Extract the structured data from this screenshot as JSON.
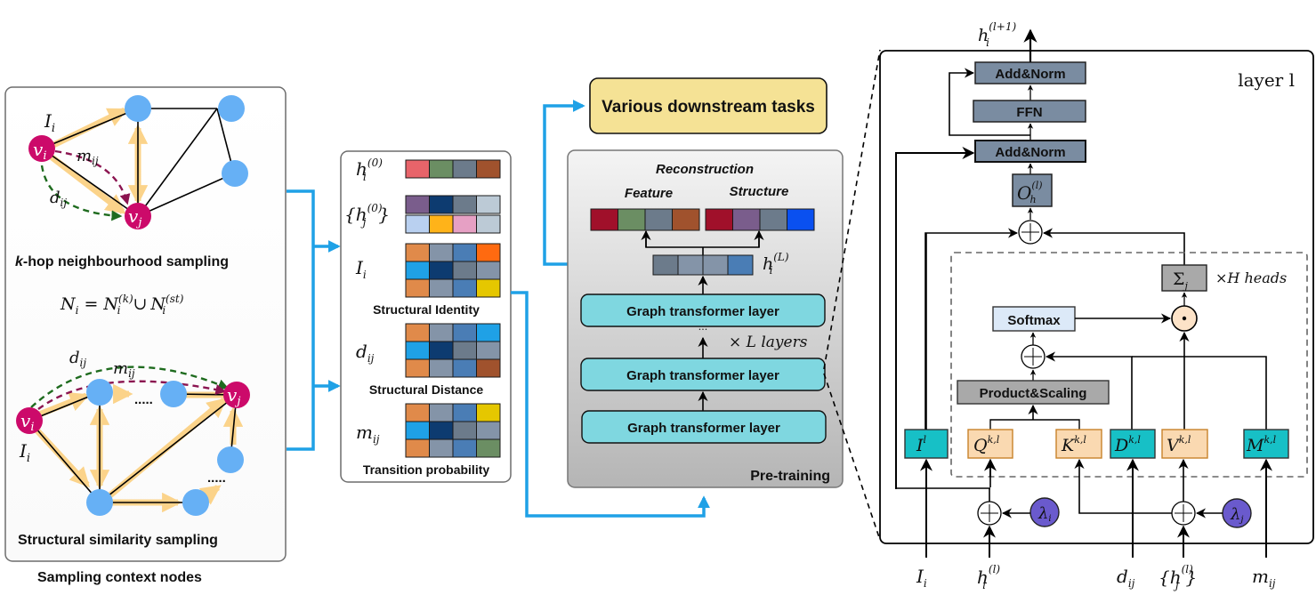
{
  "sampling_panel": {
    "caption": "Sampling context nodes",
    "khop": {
      "title_prefix": "k",
      "title_rest": "-hop neighbourhood sampling",
      "node_i": "v",
      "node_i_sub": "i",
      "node_j": "v",
      "node_j_sub": "j",
      "I_label": "I",
      "I_sub": "i",
      "m_label": "m",
      "m_sub": "ij",
      "d_label": "d",
      "d_sub": "ij"
    },
    "formula": {
      "lhs": "N",
      "lhs_sub": "i",
      "eq": "=",
      "t1": "N",
      "t1_sub": "i",
      "t1_sup": "(k)",
      "union": "∪",
      "t2": "N",
      "t2_sub": "i",
      "t2_sup": "(st)"
    },
    "structural": {
      "title": "Structural similarity sampling",
      "dots": ".....",
      "node_i": "v",
      "node_i_sub": "i",
      "node_j": "v",
      "node_j_sub": "j",
      "I_label": "I",
      "I_sub": "i",
      "d_label": "d",
      "d_sub": "ij",
      "m_label": "m",
      "m_sub": "ij"
    }
  },
  "feature_panel": {
    "rows": [
      {
        "label": "h",
        "sub": "i",
        "sup": "(0)",
        "colors": [
          [
            "#e8646a",
            "#6b8e63",
            "#6c7b8b",
            "#a0522d"
          ]
        ]
      },
      {
        "label": "{h",
        "sub": "j",
        "sup": "(0)",
        "suffix": "}",
        "colors": [
          [
            "#7a5d8c",
            "#0d3b70",
            "#6c7b8b",
            "#bccad6"
          ],
          [
            "#b9d0f0",
            "#ffb319",
            "#e6a0c4",
            "#bccad6"
          ]
        ]
      },
      {
        "label": "I",
        "sub": "i",
        "caption": "Structural Identity",
        "colors": [
          [
            "#e08a4a",
            "#8494a8",
            "#4a7db5",
            "#ff6a10"
          ],
          [
            "#1fa1e6",
            "#0d3b70",
            "#6c7b8b",
            "#8494a8"
          ],
          [
            "#e08a4a",
            "#8494a8",
            "#4a7db5",
            "#e5c700"
          ]
        ]
      },
      {
        "label": "d",
        "sub": "ij",
        "caption": "Structural Distance",
        "colors": [
          [
            "#e08a4a",
            "#8494a8",
            "#4a7db5",
            "#1fa1e6"
          ],
          [
            "#1fa1e6",
            "#0d3b70",
            "#6c7b8b",
            "#8494a8"
          ],
          [
            "#e08a4a",
            "#8494a8",
            "#4a7db5",
            "#a0522d"
          ]
        ]
      },
      {
        "label": "m",
        "sub": "ij",
        "caption": "Transition probability",
        "colors": [
          [
            "#e08a4a",
            "#8494a8",
            "#4a7db5",
            "#e5c700"
          ],
          [
            "#1fa1e6",
            "#0d3b70",
            "#6c7b8b",
            "#8494a8"
          ],
          [
            "#e08a4a",
            "#8494a8",
            "#4a7db5",
            "#6b8e63"
          ]
        ]
      }
    ]
  },
  "downstream": {
    "label": "Various downstream tasks"
  },
  "pretraining": {
    "caption": "Pre-training",
    "reconstruction": "Reconstruction",
    "feature": "Feature",
    "structure": "Structure",
    "feature_colors": [
      "#a0102a",
      "#6b8e63",
      "#6c7b8b",
      "#a0522d"
    ],
    "structure_colors": [
      "#a0102a",
      "#7a5d8c",
      "#6c7b8b",
      "#0a50f0"
    ],
    "hL_colors": [
      "#6c7b8b",
      "#8494a8",
      "#8494a8",
      "#4a7db5"
    ],
    "hL": "h",
    "hL_sub": "i",
    "hL_sup": "(L)",
    "layer_label": "Graph transformer layer",
    "times_L": "× L  layers",
    "ellipsis": "···"
  },
  "layer_detail": {
    "title": "layer l",
    "output": "h",
    "output_sub": "i",
    "output_sup": "(l+1)",
    "add_norm": "Add&Norm",
    "ffn": "FFN",
    "O": "O",
    "O_sub": "h",
    "O_sup": "(l)",
    "sigma": "Σ",
    "sigma_sub": "j",
    "heads": "×H  heads",
    "softmax": "Softmax",
    "product_scaling": "Product&Scaling",
    "odot": "⊙",
    "boxes": {
      "I": {
        "base": "I",
        "sup": "l"
      },
      "Q": {
        "base": "Q",
        "sup": "k,l"
      },
      "K": {
        "base": "K",
        "sup": "k,l"
      },
      "D": {
        "base": "D",
        "sup": "k,l"
      },
      "V": {
        "base": "V",
        "sup": "k,l"
      },
      "M": {
        "base": "M",
        "sup": "k,l"
      }
    },
    "lambda_i": "λ",
    "lambda_i_sub": "i",
    "lambda_j": "λ",
    "lambda_j_sub": "j",
    "inputs": {
      "I": {
        "base": "I",
        "sub": "i"
      },
      "h": {
        "base": "h",
        "sub": "i",
        "sup": "(l)"
      },
      "d": {
        "base": "d",
        "sub": "ij"
      },
      "hj": {
        "base": "{h",
        "sub": "j",
        "sup": "(l)",
        "suffix": "}"
      },
      "m": {
        "base": "m",
        "sub": "ij"
      }
    }
  },
  "colors": {
    "blue_arrow": "#1fa1e6",
    "node_magenta": "#cc0a6a",
    "node_blue": "#66b0f5",
    "edge_highlight": "#fbd38a",
    "dashed_red": "#8b1450",
    "dashed_green": "#1e6b1e",
    "teal": "#7fd7e0",
    "slate": "#7a8ca1",
    "cyan_box": "#17c0c6",
    "orange_box": "#fad9b1",
    "lambda": "#6a5acd",
    "downstream": "#f5e295"
  }
}
